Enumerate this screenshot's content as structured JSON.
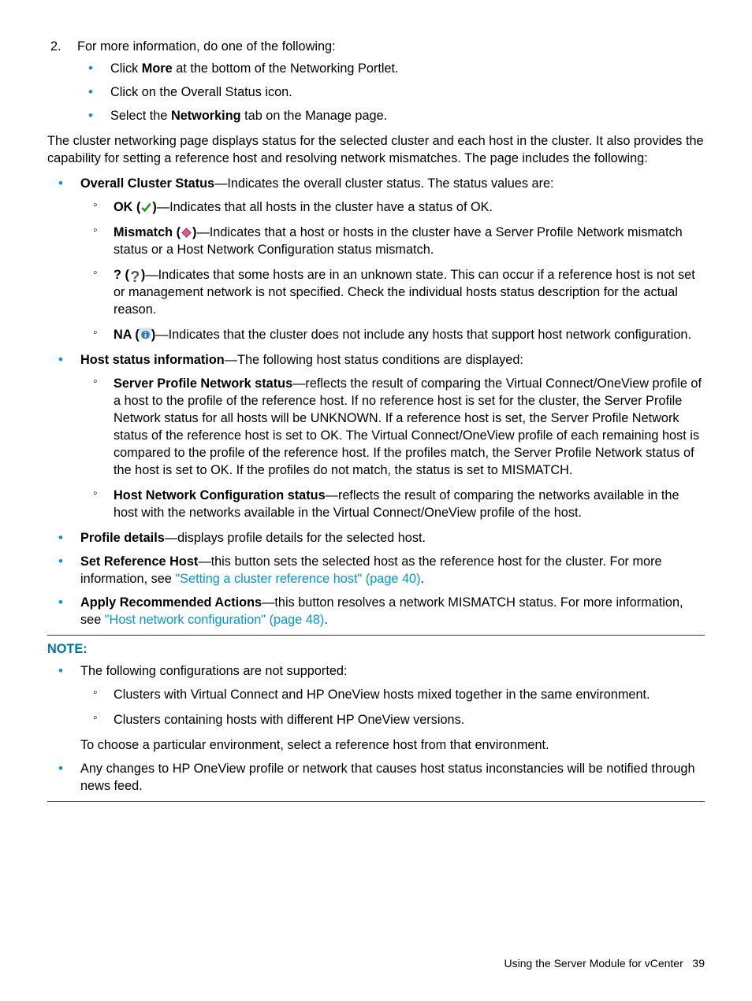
{
  "step2": {
    "num": "2",
    "text": "For more information, do one of the following:",
    "items": [
      {
        "pre": "Click ",
        "bold": "More",
        "post": " at the bottom of the Networking Portlet."
      },
      {
        "text": "Click on the Overall Status icon."
      },
      {
        "pre": "Select the ",
        "bold": "Networking",
        "post": " tab on the Manage page."
      }
    ]
  },
  "intro_para": "The cluster networking page displays status for the selected cluster and each host in the cluster. It also provides the capability for setting a reference host and resolving network mismatches. The page includes the following:",
  "overall": {
    "bold": "Overall Cluster Status",
    "post": "—Indicates the overall cluster status. The status values are:",
    "items": {
      "ok": {
        "bold": "OK (",
        "iconName": "check-icon",
        "close": ")",
        "post": "—Indicates that all hosts in the cluster have a status of OK."
      },
      "mis": {
        "bold": "Mismatch (",
        "iconName": "diamond-icon",
        "close": ")",
        "post": "—Indicates that a host or hosts in the cluster have a Server Profile Network mismatch status or a Host Network Configuration status mismatch."
      },
      "q": {
        "bold": "? (",
        "iconName": "question-icon",
        "close": ")",
        "post": "—Indicates that some hosts are in an unknown state. This can occur if a reference host is not set or management network is not specified. Check the individual hosts status description for the actual reason."
      },
      "na": {
        "bold": "NA (",
        "iconName": "info-icon",
        "close": ")",
        "post": "—Indicates that the cluster does not include any hosts that support host network configuration."
      }
    }
  },
  "host_status": {
    "bold": "Host status information",
    "post": "—The following host status conditions are displayed:",
    "spns": {
      "bold": "Server Profile Network status",
      "post": "—reflects the result of comparing the Virtual Connect/OneView profile of a host to the profile of the reference host. If no reference host is set for the cluster, the Server Profile Network status for all hosts will be UNKNOWN. If a reference host is set, the Server Profile Network status of the reference host is set to OK. The Virtual Connect/OneView profile of each remaining host is compared to the profile of the reference host. If the profiles match, the Server Profile Network status of the host is set to OK. If the profiles do not match, the status is set to MISMATCH."
    },
    "hnc": {
      "bold": "Host Network Configuration status",
      "post": "—reflects the result of comparing the networks available in the host with the networks available in the Virtual Connect/OneView profile of the host."
    }
  },
  "profile_details": {
    "bold": "Profile details",
    "post": "—displays profile details for the selected host."
  },
  "set_ref": {
    "bold": "Set Reference Host",
    "post1": "—this button sets the selected host as the reference host for the cluster. For more information, see ",
    "link": "\"Setting a cluster reference host\" (page 40)",
    "post2": "."
  },
  "apply_rec": {
    "bold": "Apply Recommended Actions",
    "post1": "—this button resolves a network MISMATCH status. For more information, see ",
    "link": "\"Host network configuration\" (page 48)",
    "post2": "."
  },
  "note": {
    "header": "NOTE:",
    "n1": "The following configurations are not supported:",
    "n1a": "Clusters with Virtual Connect and HP OneView hosts mixed together in the same environment.",
    "n1b": "Clusters containing hosts with different HP OneView versions.",
    "n1c": "To choose a particular environment, select a reference host from that environment.",
    "n2": "Any changes to HP OneView profile or network that causes host status inconstancies will be notified through news feed."
  },
  "footer": {
    "title": "Using the Server Module for vCenter",
    "page": "39"
  }
}
